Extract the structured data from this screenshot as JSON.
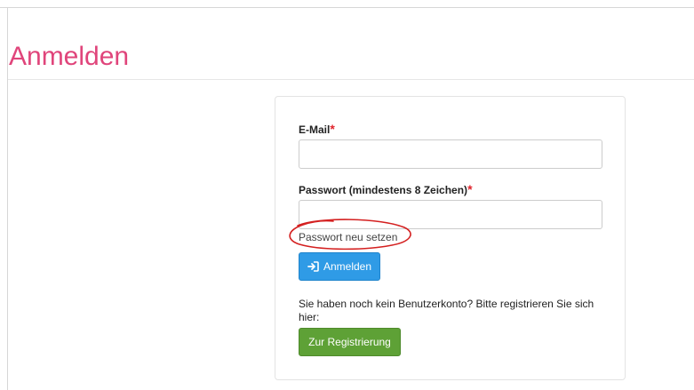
{
  "page": {
    "title": "Anmelden"
  },
  "form": {
    "email_label": "E-Mail",
    "required_marker": "*",
    "email_value": "",
    "password_label": "Passwort (mindestens 8 Zeichen)",
    "password_value": "",
    "reset_link": "Passwort neu setzen",
    "login_button": "Anmelden",
    "login_icon": "sign-in-icon",
    "no_account_text": "Sie haben noch kein Benutzerkonto? Bitte registrieren Sie sich hier:",
    "register_button": "Zur Registrierung"
  },
  "colors": {
    "title": "#e0457b",
    "required": "#e0242c",
    "login_button": "#2f9be6",
    "register_button": "#5ea136",
    "annotation": "#d42020"
  }
}
